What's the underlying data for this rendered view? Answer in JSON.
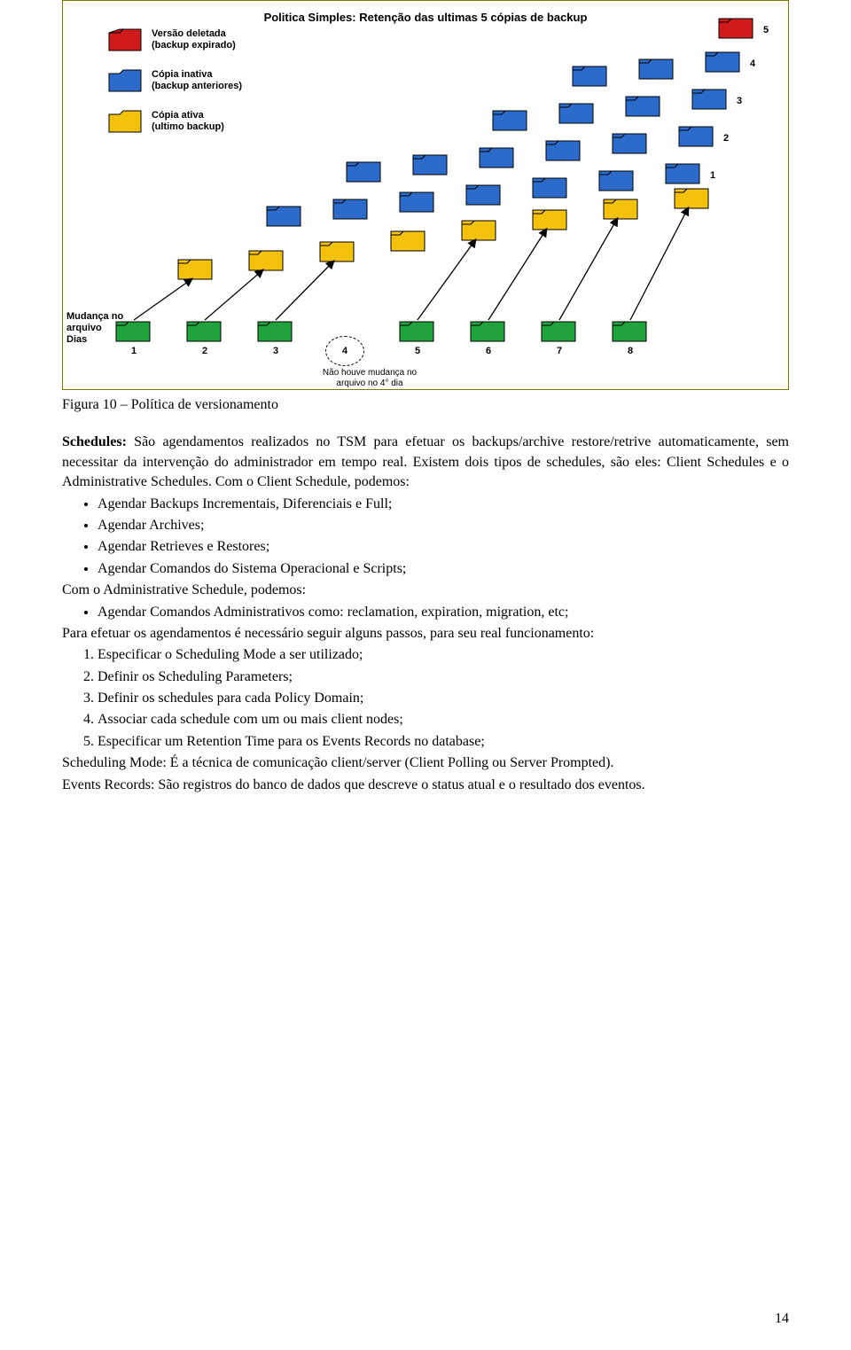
{
  "diagram": {
    "title": "Politica Simples: Retenção das ultimas 5 cópias de backup",
    "legend": {
      "deleted": {
        "l1": "Versão deletada",
        "l2": "(backup expirado)"
      },
      "inactive": {
        "l1": "Cópia inativa",
        "l2": "(backup anteriores)"
      },
      "active": {
        "l1": "Cópia ativa",
        "l2": "(ultimo backup)"
      }
    },
    "footnote": {
      "l1": "Não houve mudança no",
      "l2": "arquivo no 4° dia"
    },
    "axis": {
      "l1": "Mudança no",
      "l2": "arquivo",
      "l3": "Dias"
    },
    "days": [
      "1",
      "2",
      "3",
      "4",
      "5",
      "6",
      "7",
      "8"
    ],
    "row_nums": [
      "1",
      "2",
      "3",
      "4",
      "5"
    ]
  },
  "caption": "Figura 10 – Política de versionamento",
  "para1_prefix": "Schedules:",
  "para1_rest": " São agendamentos realizados no TSM para efetuar os backups/archive restore/retrive automaticamente, sem necessitar da intervenção do administrador em tempo real. Existem dois tipos de schedules, são eles: Client Schedules e o Administrative Schedules. Com o Client Schedule, podemos:",
  "client_bullets": [
    "Agendar Backups Incrementais, Diferenciais e Full;",
    "Agendar Archives;",
    "Agendar Retrieves e Restores;",
    "Agendar Comandos do Sistema Operacional e Scripts;"
  ],
  "admin_intro": "Com o Administrative Schedule, podemos:",
  "admin_bullets": [
    "Agendar Comandos Administrativos como: reclamation, expiration, migration, etc;"
  ],
  "steps_intro": "Para efetuar os agendamentos é necessário seguir alguns passos, para seu real funcionamento:",
  "steps": [
    "Especificar o Scheduling Mode a ser utilizado;",
    "Definir os Scheduling Parameters;",
    "Definir os schedules para cada Policy Domain;",
    "Associar cada schedule com um ou mais client nodes;",
    "Especificar um Retention Time para os Events Records no database;"
  ],
  "sched_mode": "Scheduling Mode: É a técnica de comunicação client/server (Client Polling ou Server Prompted).",
  "events": "Events Records: São registros do banco de dados que descreve o status atual e o resultado dos eventos.",
  "page_number": "14"
}
